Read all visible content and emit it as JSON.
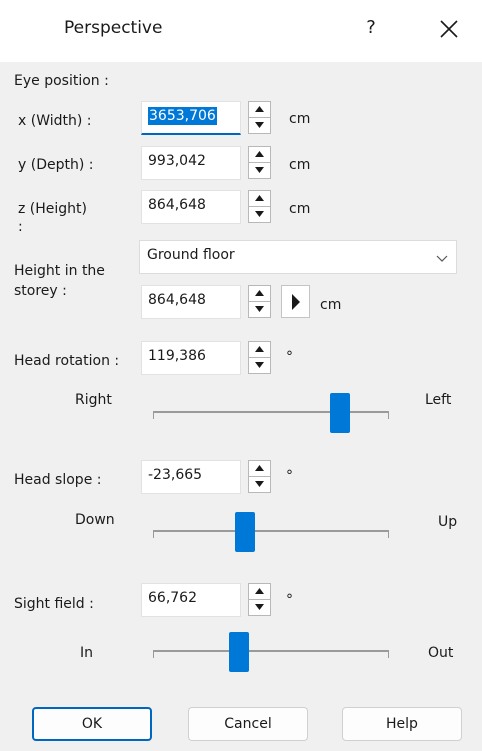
{
  "window": {
    "title": "Perspective",
    "help_glyph": "?",
    "close_icon": "close-icon"
  },
  "eye_position": {
    "heading": "Eye position :",
    "x": {
      "label": "x (Width) :",
      "value": "3653,706",
      "unit": "cm"
    },
    "y": {
      "label": "y (Depth) :",
      "value": "993,042",
      "unit": "cm"
    },
    "z": {
      "label_line1": "z (Height)",
      "label_line2": ":",
      "value": "864,648",
      "unit": "cm"
    }
  },
  "height_in_storey": {
    "label_line1": "Height in the",
    "label_line2": "storey :",
    "storey_selected": "Ground floor",
    "value": "864,648",
    "unit": "cm"
  },
  "head_rotation": {
    "label": "Head rotation :",
    "value": "119,386",
    "unit": "°",
    "left_label": "Right",
    "right_label": "Left",
    "slider_fraction": 0.82
  },
  "head_slope": {
    "label": "Head slope :",
    "value": "-23,665",
    "unit": "°",
    "left_label": "Down",
    "right_label": "Up",
    "slider_fraction": 0.38
  },
  "sight_field": {
    "label": "Sight field :",
    "value": "66,762",
    "unit": "°",
    "left_label": "In",
    "right_label": "Out",
    "slider_fraction": 0.35
  },
  "buttons": {
    "ok": "OK",
    "cancel": "Cancel",
    "help": "Help"
  },
  "colors": {
    "accent": "#0078d7",
    "dialog_bg": "#f0f0f0"
  }
}
